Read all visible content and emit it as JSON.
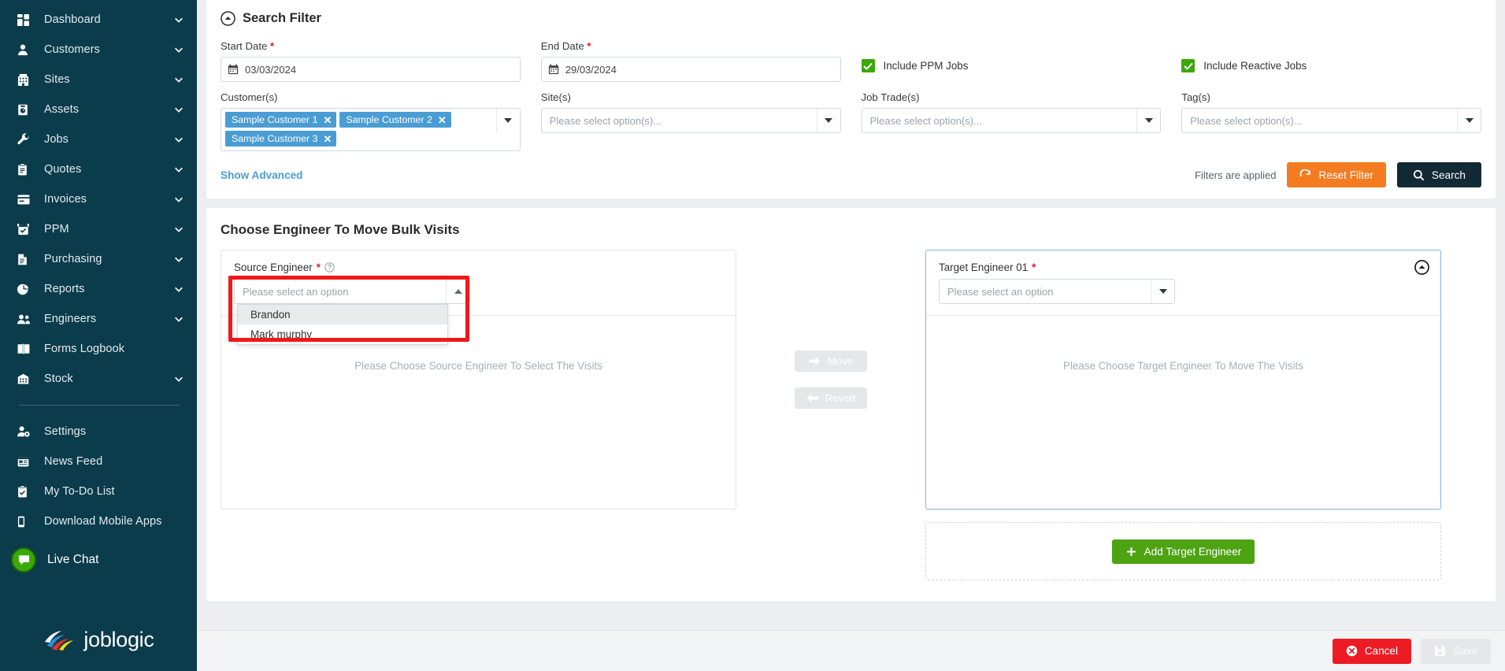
{
  "sidebar": {
    "items": [
      {
        "label": "Dashboard",
        "icon": "dashboard-icon",
        "expandable": true
      },
      {
        "label": "Customers",
        "icon": "user-icon",
        "expandable": true
      },
      {
        "label": "Sites",
        "icon": "building-icon",
        "expandable": true
      },
      {
        "label": "Assets",
        "icon": "asset-icon",
        "expandable": true
      },
      {
        "label": "Jobs",
        "icon": "wrench-icon",
        "expandable": true
      },
      {
        "label": "Quotes",
        "icon": "clipboard-icon",
        "expandable": true
      },
      {
        "label": "Invoices",
        "icon": "invoice-icon",
        "expandable": true
      },
      {
        "label": "PPM",
        "icon": "calendar-check-icon",
        "expandable": true
      },
      {
        "label": "Purchasing",
        "icon": "document-icon",
        "expandable": true
      },
      {
        "label": "Reports",
        "icon": "pie-chart-icon",
        "expandable": true
      },
      {
        "label": "Engineers",
        "icon": "users-icon",
        "expandable": true
      },
      {
        "label": "Forms Logbook",
        "icon": "book-icon",
        "expandable": false
      },
      {
        "label": "Stock",
        "icon": "warehouse-icon",
        "expandable": true
      }
    ],
    "secondary_items": [
      {
        "label": "Settings",
        "icon": "user-gear-icon"
      },
      {
        "label": "News Feed",
        "icon": "news-icon"
      },
      {
        "label": "My To-Do List",
        "icon": "todo-clipboard-icon"
      },
      {
        "label": "Download Mobile Apps",
        "icon": "mobile-icon"
      }
    ],
    "live_chat": {
      "label": "Live Chat",
      "icon": "chat-bubble-icon",
      "color": "#3aa80a"
    },
    "brand": {
      "name": "joblogic",
      "icon": "joblogic-swoosh-icon"
    },
    "background": "#0b3c4c"
  },
  "search_filter": {
    "title": "Search Filter",
    "collapse_icon": "chevron-up-circle-icon",
    "start_date": {
      "label": "Start Date",
      "required": true,
      "value": "03/03/2024",
      "icon": "calendar-icon"
    },
    "end_date": {
      "label": "End Date",
      "required": true,
      "value": "29/03/2024",
      "icon": "calendar-icon"
    },
    "checkboxes": [
      {
        "label": "Include PPM Jobs",
        "checked": true
      },
      {
        "label": "Include Reactive Jobs",
        "checked": true
      }
    ],
    "customers": {
      "label": "Customer(s)",
      "tags": [
        "Sample Customer 1",
        "Sample Customer 2",
        "Sample Customer 3"
      ]
    },
    "sites": {
      "label": "Site(s)",
      "placeholder": "Please select option(s)..."
    },
    "job_trades": {
      "label": "Job Trade(s)",
      "placeholder": "Please select option(s)..."
    },
    "tags_field": {
      "label": "Tag(s)",
      "placeholder": "Please select option(s)..."
    },
    "show_advanced": "Show Advanced",
    "filters_applied_text": "Filters are applied",
    "reset_button": {
      "label": "Reset Filter",
      "icon": "refresh-icon",
      "color": "#f47b20"
    },
    "search_button": {
      "label": "Search",
      "icon": "magnifier-icon",
      "color": "#122a36"
    }
  },
  "move_section": {
    "title": "Choose Engineer To Move Bulk Visits",
    "source": {
      "label": "Source Engineer",
      "required": true,
      "help_icon": "question-circle-icon",
      "placeholder": "Please select an option",
      "dropdown_open": true,
      "options": [
        {
          "label": "Brandon",
          "highlighted": true
        },
        {
          "label": "Mark murphy",
          "highlighted": false
        }
      ],
      "empty_text": "Please Choose Source Engineer To Select The Visits",
      "annotation_color": "#f01818"
    },
    "move_button": {
      "label": "Move",
      "icon": "arrow-right-icon",
      "disabled": true
    },
    "revert_button": {
      "label": "Revert",
      "icon": "arrow-left-icon",
      "disabled": true
    },
    "target": {
      "label": "Target Engineer 01",
      "required": true,
      "placeholder": "Please select an option",
      "empty_text": "Please Choose Target Engineer To Move The Visits",
      "collapse_icon": "chevron-up-circle-icon"
    },
    "add_target_button": {
      "label": "Add Target Engineer",
      "icon": "plus-icon",
      "color": "#4ea312"
    }
  },
  "footer": {
    "cancel_button": {
      "label": "Cancel",
      "icon": "close-circle-icon",
      "color": "#ed1c24"
    },
    "save_button": {
      "label": "Save",
      "icon": "floppy-disk-icon",
      "disabled": true
    }
  }
}
